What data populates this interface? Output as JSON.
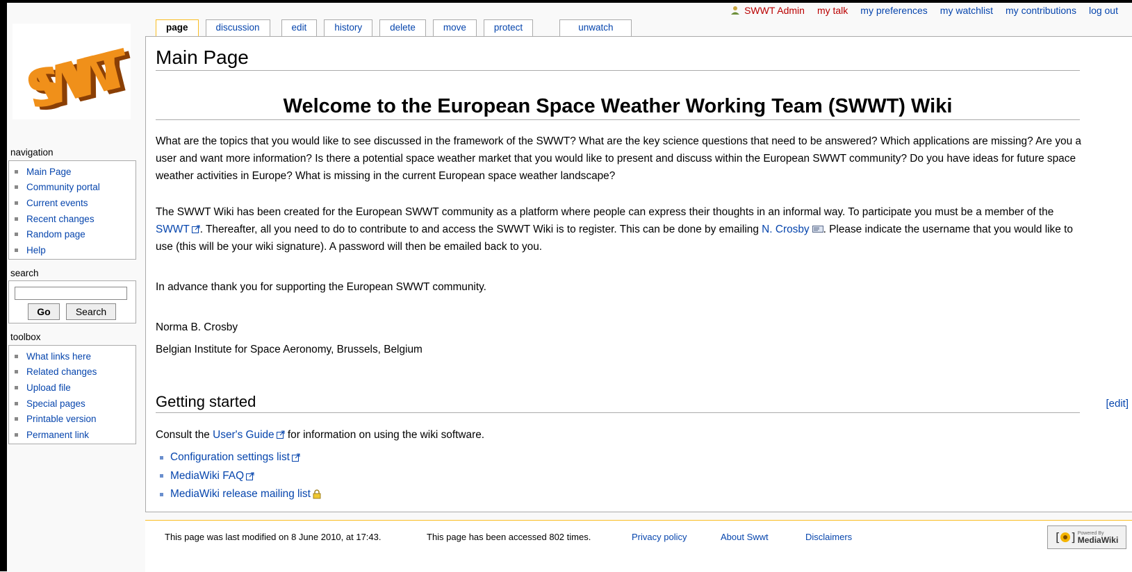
{
  "personal": {
    "username": "SWWT Admin",
    "talk": "my talk",
    "preferences": "my preferences",
    "watchlist": "my watchlist",
    "contributions": "my contributions",
    "logout": "log out"
  },
  "tabs": {
    "page": "page",
    "discussion": "discussion",
    "edit": "edit",
    "history": "history",
    "delete": "delete",
    "move": "move",
    "protect": "protect",
    "unwatch": "unwatch"
  },
  "logo_text": "SWWT",
  "page_title": "Main Page",
  "welcome_heading": "Welcome to the European Space Weather Working Team (SWWT) Wiki",
  "intro_paragraph": "What are the topics that you would like to see discussed in the framework of the SWWT? What are the key science questions that need to be answered? Which applications are missing? Are you a user and want more information? Is there a potential space weather market that you would like to present and discuss within the European SWWT community? Do you have ideas for future space weather activities in Europe? What is missing in the current European space weather landscape?",
  "participation": {
    "part1": "The SWWT Wiki has been created for the European SWWT community as a platform where people can express their thoughts in an informal way. To participate you must be a member of the ",
    "swwt_link": "SWWT",
    "part2": ". Thereafter, all you need to do to contribute to and access the SWWT Wiki is to register. This can be done by emailing ",
    "crosby_link": "N. Crosby",
    "part3": ". Please indicate the username that you would like to use (this will be your wiki signature). A password will then be emailed back to you."
  },
  "thanks": "In advance thank you for supporting the European SWWT community.",
  "signature_name": "Norma B. Crosby",
  "signature_institute": "Belgian Institute for Space Aeronomy, Brussels, Belgium",
  "getting_started": {
    "heading": "Getting started",
    "edit_link": "[edit]",
    "consult_pre": "Consult the ",
    "users_guide": "User's Guide",
    "consult_post": " for information on using the wiki software.",
    "links": [
      "Configuration settings list",
      "MediaWiki FAQ",
      "MediaWiki release mailing list"
    ]
  },
  "sidebar": {
    "navigation_title": "navigation",
    "navigation": [
      "Main Page",
      "Community portal",
      "Current events",
      "Recent changes",
      "Random page",
      "Help"
    ],
    "search_title": "search",
    "go_button": "Go",
    "search_button": "Search",
    "toolbox_title": "toolbox",
    "toolbox": [
      "What links here",
      "Related changes",
      "Upload file",
      "Special pages",
      "Printable version",
      "Permanent link"
    ]
  },
  "footer": {
    "last_modified": "This page was last modified on 8 June 2010, at 17:43.",
    "accessed": "This page has been accessed 802 times.",
    "privacy": "Privacy policy",
    "about": "About Swwt",
    "disclaimers": "Disclaimers",
    "powered_small": "Powered By",
    "powered_big": "MediaWiki"
  },
  "colors": {
    "link": "#0645ad",
    "user_link": "#ba0000",
    "logo_fill": "#e07a10",
    "tab_selected_border": "#fabd23"
  }
}
